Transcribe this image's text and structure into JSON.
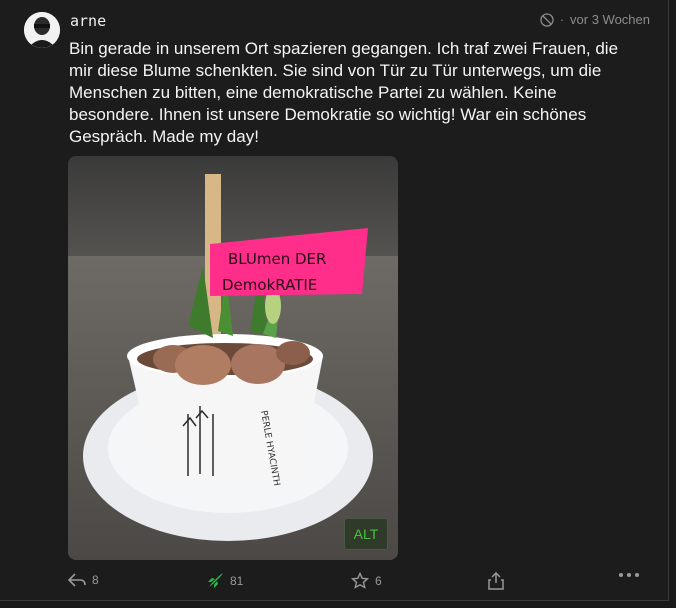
{
  "post": {
    "username": "arne",
    "timestamp": "vor 3 Wochen",
    "text": "Bin gerade in unserem Ort spazieren gegangen. Ich traf zwei Frauen, die mir diese Blume schenkten. Sie sind von Tür zu Tür unterwegs, um die Menschen zu bitten, eine demokratische Partei zu wählen. Keine besondere. Ihnen ist unsere Demokratie so wichtig! War ein schönes Gespräch. Made my day!",
    "image": {
      "alt_badge": "ALT",
      "sign_line1": "BLUmen DER",
      "sign_line2": "DemokRATIE",
      "pot_text": "PERLE HYACINTH"
    },
    "actions": {
      "reply_count": "8",
      "boost_count": "81",
      "favourite_count": "6"
    }
  },
  "colors": {
    "background": "#1c1c1c",
    "text": "#f4f4f4",
    "muted": "#8c8c8c",
    "boost_green": "#2ebd4a",
    "alt_green": "#49c23a",
    "sign_pink": "#ff2e8a"
  },
  "icons": [
    "avatar",
    "visibility-icon",
    "reply-icon",
    "boost-icon",
    "star-icon",
    "share-icon",
    "more-icon"
  ]
}
